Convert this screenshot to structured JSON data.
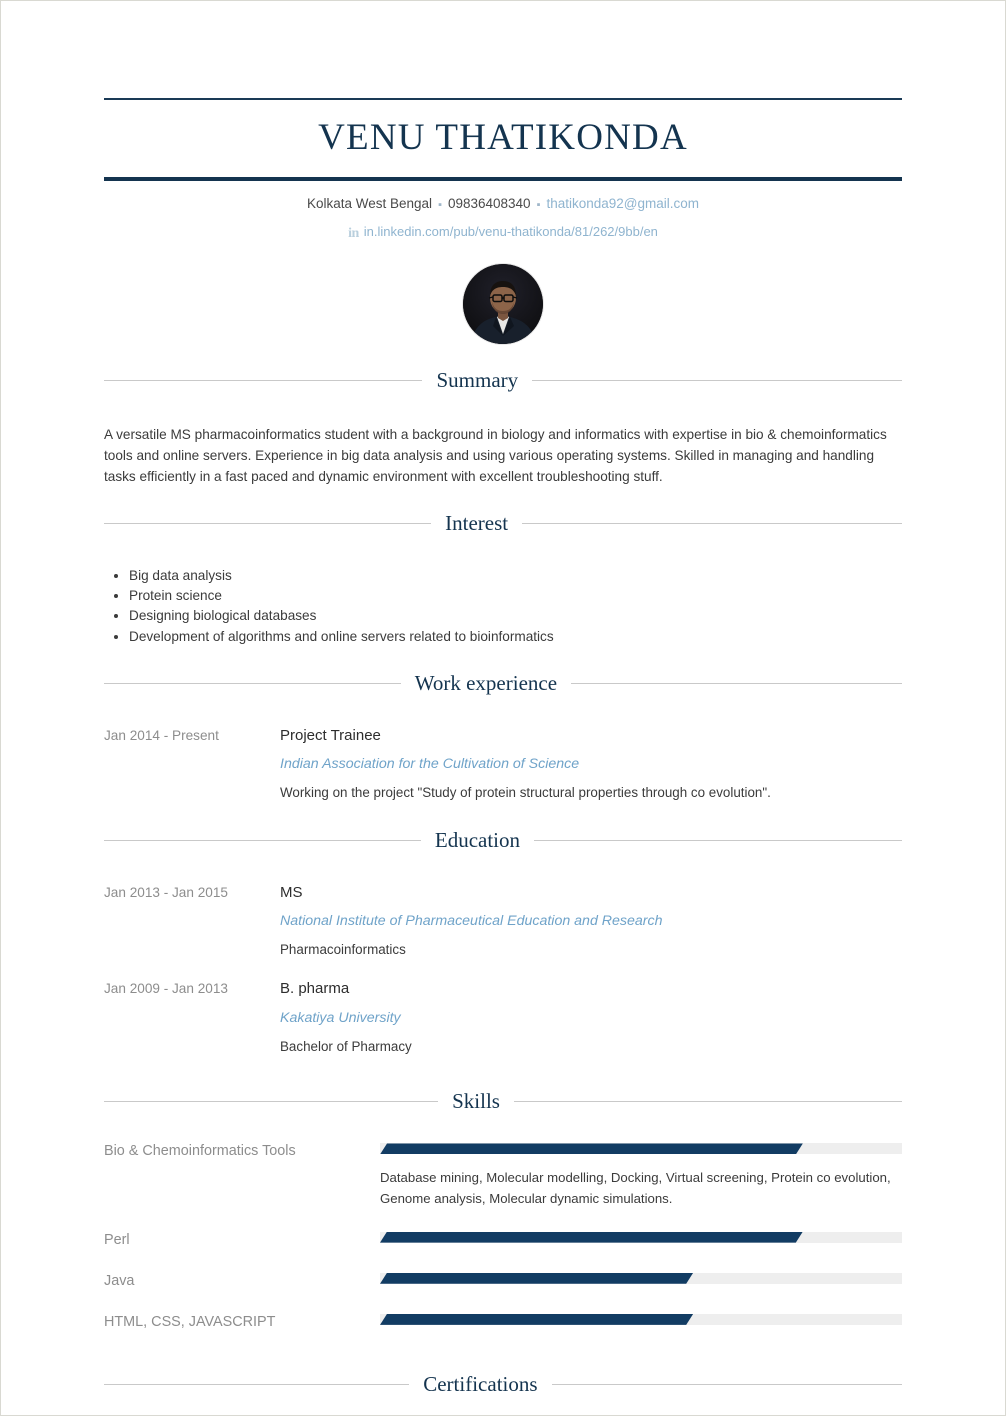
{
  "header": {
    "name": "VENU THATIKONDA",
    "location": "Kolkata West Bengal",
    "phone": "09836408340",
    "email": "thatikonda92@gmail.com",
    "separator": "▪",
    "linkedin_icon": "in",
    "linkedin": "in.linkedin.com/pub/venu-thatikonda/81/262/9bb/en",
    "photo_alt": "profile-photo"
  },
  "sections": {
    "summary": {
      "title": "Summary",
      "text": "A versatile MS pharmacoinformatics student with a background in biology and informatics with expertise in bio & chemoinformatics tools and online servers. Experience in big data analysis and using various operating systems.  Skilled in managing and handling tasks efficiently in a fast paced and dynamic environment with excellent troubleshooting stuff."
    },
    "interest": {
      "title": "Interest",
      "items": [
        "Big data analysis",
        "Protein science",
        "Designing biological databases",
        "Development of algorithms and online servers related to bioinformatics"
      ]
    },
    "work": {
      "title": "Work experience",
      "entries": [
        {
          "dates": "Jan 2014 - Present",
          "role": "Project Trainee",
          "org": "Indian Association for the Cultivation of Science",
          "detail": "Working on the project \"Study of protein structural properties through co evolution\"."
        }
      ]
    },
    "education": {
      "title": "Education",
      "entries": [
        {
          "dates": "Jan 2013 - Jan 2015",
          "degree": "MS",
          "school": "National Institute of Pharmaceutical Education and Research",
          "field": "Pharmacoinformatics"
        },
        {
          "dates": "Jan 2009 - Jan 2013",
          "degree": "B. pharma",
          "school": "Kakatiya University",
          "field": "Bachelor of Pharmacy"
        }
      ]
    },
    "skills": {
      "title": "Skills",
      "items": [
        {
          "name": "Bio & Chemoinformatics Tools",
          "level": 81,
          "description": "Database mining, Molecular modelling, Docking, Virtual screening, Protein co evolution, Genome analysis, Molecular dynamic simulations."
        },
        {
          "name": "Perl",
          "level": 81,
          "description": ""
        },
        {
          "name": "Java",
          "level": 60,
          "description": ""
        },
        {
          "name": "HTML, CSS, JAVASCRIPT",
          "level": 60,
          "description": ""
        }
      ]
    },
    "certifications": {
      "title": "Certifications"
    }
  },
  "colors": {
    "accent_navy": "#14344f",
    "bar_fill": "#123c63",
    "bar_track": "#eeeeee",
    "link_blue": "#8fb4cf",
    "muted_gray": "#8d8d8d"
  }
}
